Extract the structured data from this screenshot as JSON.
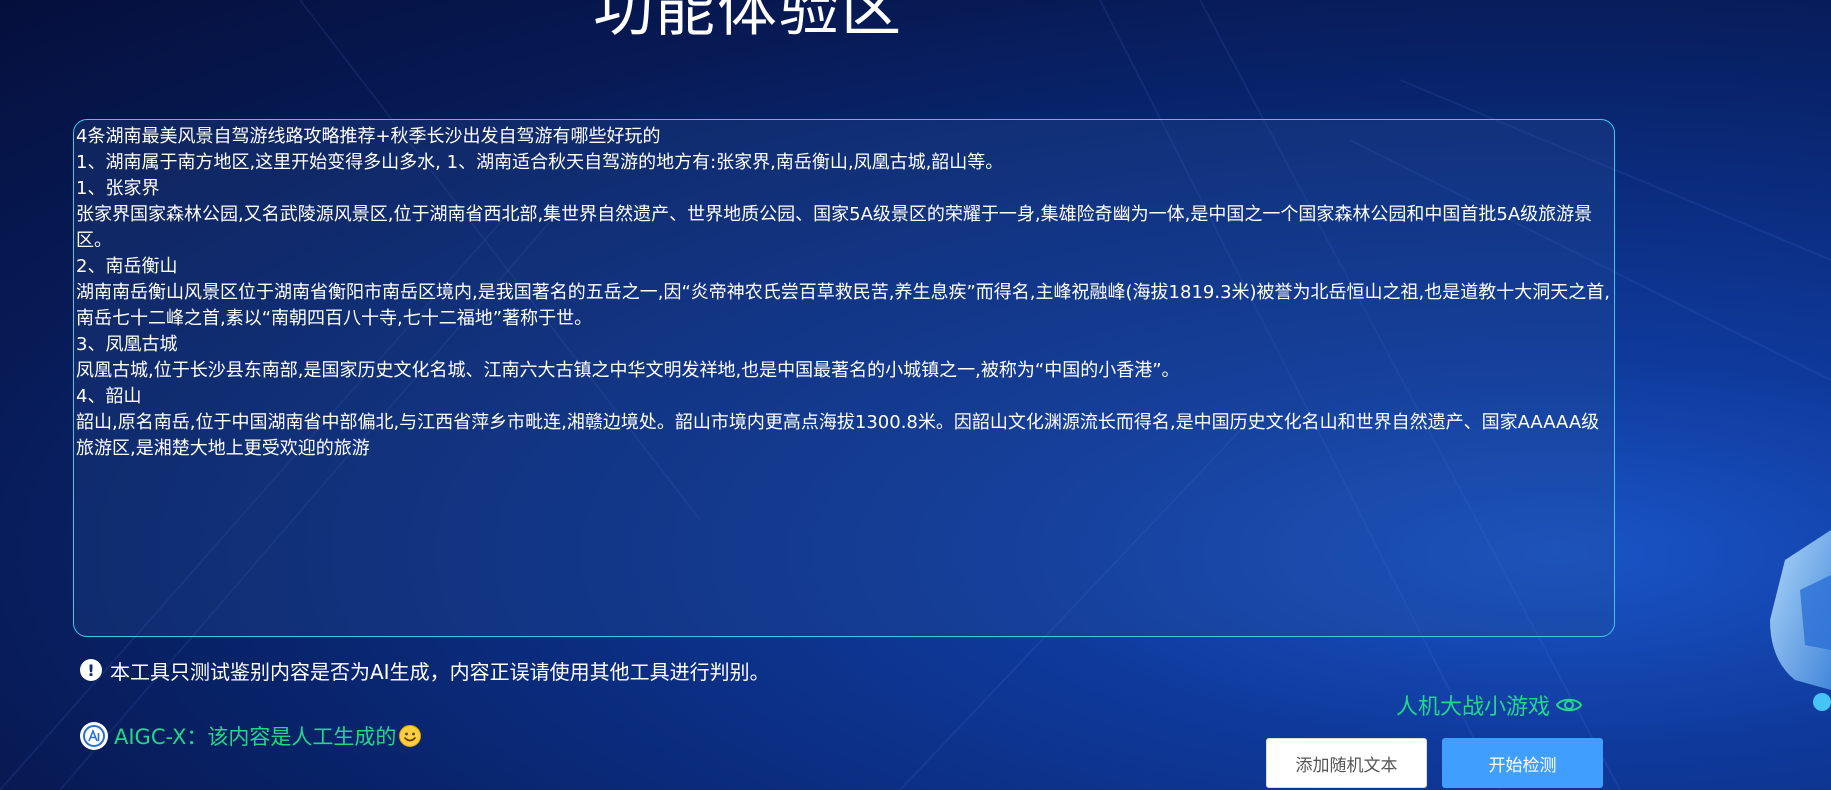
{
  "page": {
    "title": "功能体验区"
  },
  "input_text": {
    "lines": [
      "4条湖南最美风景自驾游线路攻略推荐+秋季长沙出发自驾游有哪些好玩的",
      "",
      "1、湖南属于南方地区,这里开始变得多山多水, 1、湖南适合秋天自驾游的地方有:张家界,南岳衡山,凤凰古城,韶山等。",
      "1、张家界",
      "张家界国家森林公园,又名武陵源风景区,位于湖南省西北部,集世界自然遗产、世界地质公园、国家5A级景区的荣耀于一身,集雄险奇幽为一体,是中国之一个国家森林公园和中国首批5A级旅游景区。",
      "2、南岳衡山",
      "湖南南岳衡山风景区位于湖南省衡阳市南岳区境内,是我国著名的五岳之一,因“炎帝神农氏尝百草救民苦,养生息疾”而得名,主峰祝融峰(海拔1819.3米)被誉为北岳恒山之祖,也是道教十大洞天之首,南岳七十二峰之首,素以“南朝四百八十寺,七十二福地”著称于世。",
      "3、凤凰古城",
      "凤凰古城,位于长沙县东南部,是国家历史文化名城、江南六大古镇之中华文明发祥地,也是中国最著名的小城镇之一,被称为“中国的小香港”。",
      "4、韶山",
      "韶山,原名南岳,位于中国湖南省中部偏北,与江西省萍乡市毗连,湘赣边境处。韶山市境内更高点海拔1300.8米。因韶山文化渊源流长而得名,是中国历史文化名山和世界自然遗产、国家AAAAA级旅游区,是湘楚大地上更受欢迎的旅游"
    ]
  },
  "notice": {
    "icon": "exclamation-circle-icon",
    "text": "本工具只测试鉴别内容是否为AI生成，内容正误请使用其他工具进行判别。"
  },
  "game_link": {
    "label": "人机大战小游戏",
    "icon": "eye-icon"
  },
  "result": {
    "logo": "aigc-x-logo",
    "text": "AIGC-X：该内容是人工生成的",
    "emoji": "smiley-icon"
  },
  "buttons": {
    "add_random": "添加随机文本",
    "start_detect": "开始检测"
  },
  "colors": {
    "accent_green": "#22d68a",
    "primary_blue": "#409eff",
    "border_cyan": "#3fc8e6",
    "background_dark": "#071a55"
  }
}
